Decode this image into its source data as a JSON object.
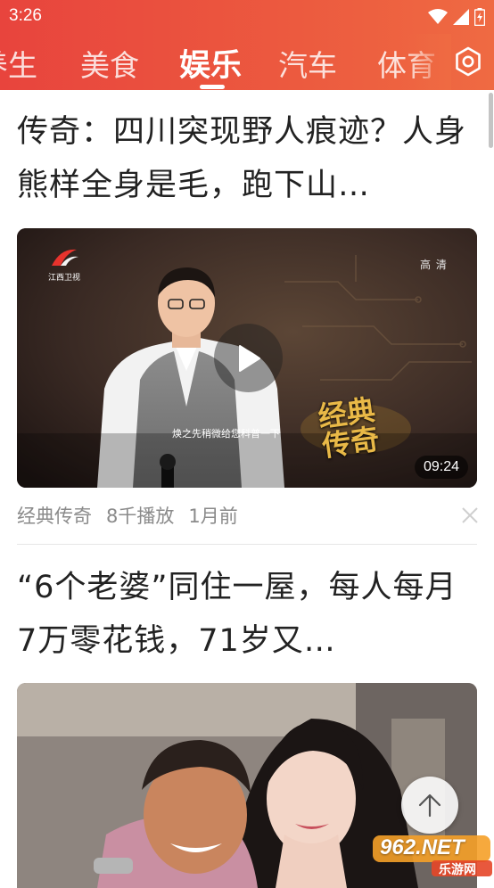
{
  "status_bar": {
    "time": "3:26"
  },
  "tabs": [
    {
      "label": "养生"
    },
    {
      "label": "美食"
    },
    {
      "label": "娱乐",
      "active": true
    },
    {
      "label": "汽车"
    },
    {
      "label": "体育"
    }
  ],
  "articles": [
    {
      "title": "传奇：四川突现野人痕迹？人身熊样全身是毛，跑下山…",
      "video": {
        "channel_logo": "江西卫视",
        "quality": "高 清",
        "subtitle": "焕之先稍微给您科普一下",
        "show_logo": "经典传奇",
        "duration": "09:24"
      },
      "source": "经典传奇",
      "plays": "8千播放",
      "time": "1月前"
    },
    {
      "title": "“6个老婆”同住一屋，每人每月7万零花钱，71岁又…"
    }
  ],
  "watermark": {
    "brand": "962.NET",
    "sub": "乐游网"
  },
  "colors": {
    "header_start": "#e8443d",
    "header_end": "#ef6a42"
  }
}
